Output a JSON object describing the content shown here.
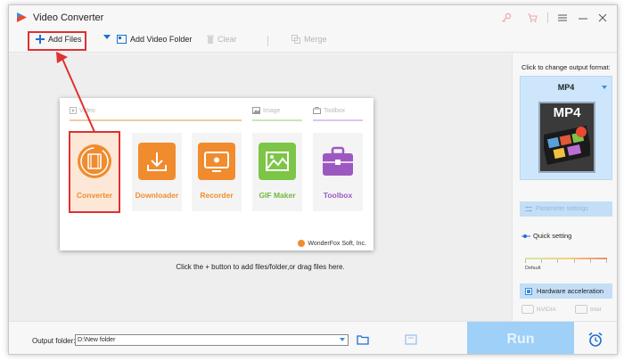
{
  "window": {
    "title": "Video Converter"
  },
  "titlebar": {
    "icons": [
      "key-icon",
      "cart-icon",
      "menu-icon",
      "minimize-icon",
      "close-icon"
    ]
  },
  "toolbar": {
    "add_files": "Add Files",
    "add_video_folder": "Add Video Folder",
    "clear": "Clear",
    "merge": "Merge"
  },
  "launcher": {
    "categories": {
      "video": "Video",
      "image": "Image",
      "toolbox": "Toolbox"
    },
    "tiles": [
      {
        "label": "Converter",
        "color": "#f08c2e"
      },
      {
        "label": "Downloader",
        "color": "#f08c2e"
      },
      {
        "label": "Recorder",
        "color": "#f08c2e"
      },
      {
        "label": "GIF Maker",
        "color": "#7cc547"
      },
      {
        "label": "Toolbox",
        "color": "#9d59c2"
      }
    ],
    "credit": "WonderFox Soft, Inc."
  },
  "hint": "Click the + button to add files/folder,or drag files here.",
  "panel": {
    "change_format_label": "Click to change output format:",
    "format": "MP4",
    "format_badge": "MP4",
    "parameter_settings": "Parameter settings",
    "quick_setting": "Quick setting",
    "default_label": "Default",
    "hardware_acceleration": "Hardware acceleration",
    "nvidia": "NVIDIA",
    "intel": "Intel"
  },
  "bottom": {
    "output_folder_label": "Output folder:",
    "output_folder_value": "D:\\New folder",
    "run": "Run"
  },
  "colors": {
    "accent": "#3c8de0",
    "highlight": "#e03030",
    "run": "#9ed0f8"
  }
}
